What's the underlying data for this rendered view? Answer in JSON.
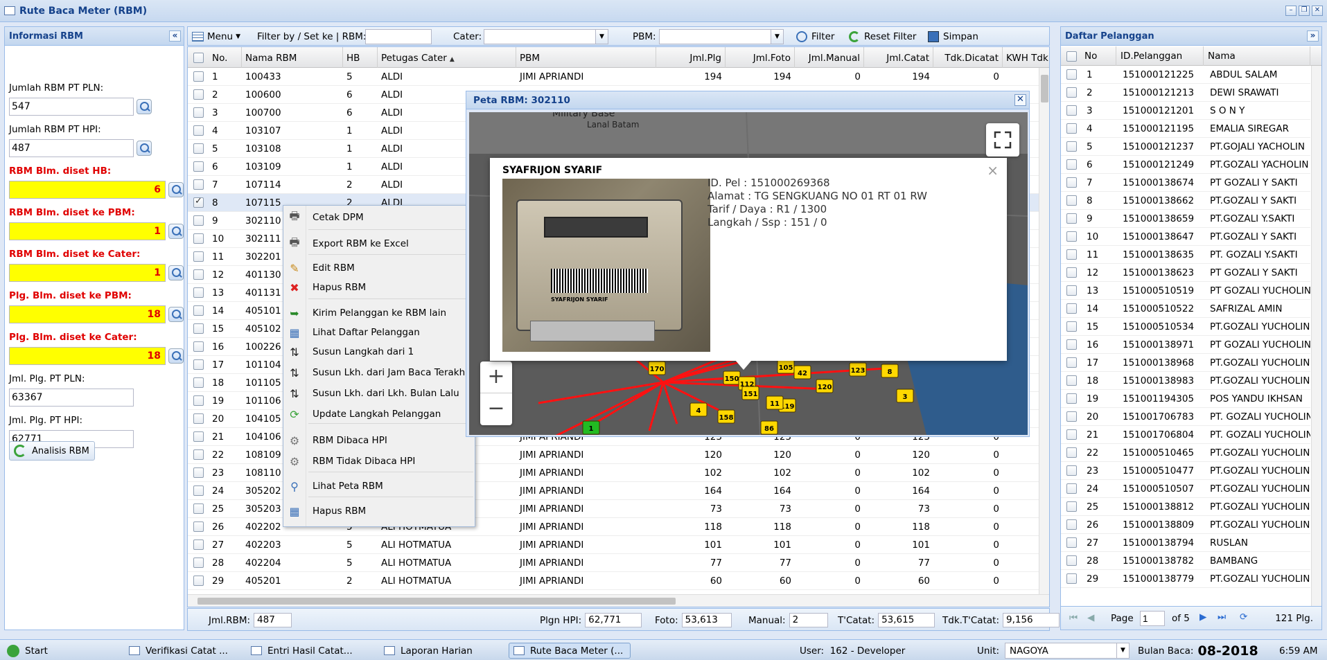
{
  "window": {
    "title": "Rute Baca Meter (RBM)"
  },
  "left_panel": {
    "title": "Informasi RBM",
    "fields": [
      {
        "label": "Jumlah RBM PT PLN:",
        "value": "547"
      },
      {
        "label": "Jumlah RBM PT HPI:",
        "value": "487"
      },
      {
        "label": "RBM Blm. diset HB:",
        "value": "6"
      },
      {
        "label": "RBM Blm. diset ke PBM:",
        "value": "1"
      },
      {
        "label": "RBM Blm. diset ke Cater:",
        "value": "1"
      },
      {
        "label": "Plg. Blm. diset ke PBM:",
        "value": "18"
      },
      {
        "label": "Plg. Blm. diset ke Cater:",
        "value": "18"
      },
      {
        "label": "Jml. Plg. PT PLN:",
        "value": "63367"
      },
      {
        "label": "Jml. Plg. PT HPI:",
        "value": "62771"
      }
    ],
    "analisis_button": "Analisis RBM"
  },
  "toolbar": {
    "menu_label": "Menu",
    "filter_label": "Filter by / Set ke | RBM:",
    "rbm_value": "",
    "cater_label": "Cater:",
    "cater_value": "",
    "pbm_label": "PBM:",
    "pbm_value": "",
    "filter_button": "Filter",
    "reset_button": "Reset Filter",
    "simpan_button": "Simpan"
  },
  "grid": {
    "columns": [
      "No.",
      "Nama RBM",
      "HB",
      "Petugas Cater",
      "PBM",
      "Jml.Plg",
      "Jml.Foto",
      "Jml.Manual",
      "Jml.Catat",
      "Tdk.Dicatat",
      "KWH Tdk Catat R"
    ],
    "rows": [
      [
        "1",
        "100433",
        "5",
        "ALDI",
        "JIMI APRIANDI",
        "194",
        "194",
        "0",
        "194",
        "0"
      ],
      [
        "2",
        "100600",
        "6",
        "ALDI",
        "",
        "",
        "",
        "",
        "",
        ""
      ],
      [
        "3",
        "100700",
        "6",
        "ALDI",
        "",
        "",
        "",
        "",
        "",
        ""
      ],
      [
        "4",
        "103107",
        "1",
        "ALDI",
        "",
        "",
        "",
        "",
        "",
        ""
      ],
      [
        "5",
        "103108",
        "1",
        "ALDI",
        "",
        "",
        "",
        "",
        "",
        ""
      ],
      [
        "6",
        "103109",
        "1",
        "ALDI",
        "",
        "",
        "",
        "",
        "",
        ""
      ],
      [
        "7",
        "107114",
        "2",
        "ALDI",
        "",
        "",
        "",
        "",
        "",
        ""
      ],
      [
        "8",
        "107115",
        "2",
        "ALDI",
        "",
        "",
        "",
        "",
        "",
        ""
      ],
      [
        "9",
        "302110",
        "",
        "",
        "",
        "",
        "",
        "",
        "",
        ""
      ],
      [
        "10",
        "302111",
        "",
        "",
        "",
        "",
        "",
        "",
        "",
        ""
      ],
      [
        "11",
        "302201",
        "",
        "",
        "",
        "",
        "",
        "",
        "",
        ""
      ],
      [
        "12",
        "401130",
        "",
        "",
        "",
        "",
        "",
        "",
        "",
        ""
      ],
      [
        "13",
        "401131",
        "",
        "",
        "",
        "",
        "",
        "",
        "",
        ""
      ],
      [
        "14",
        "405101",
        "",
        "",
        "",
        "",
        "",
        "",
        "",
        ""
      ],
      [
        "15",
        "405102",
        "",
        "",
        "",
        "",
        "",
        "",
        "",
        ""
      ],
      [
        "16",
        "100226",
        "",
        "",
        "",
        "",
        "",
        "",
        "",
        ""
      ],
      [
        "17",
        "101104",
        "",
        "",
        "",
        "",
        "",
        "",
        "",
        ""
      ],
      [
        "18",
        "101105",
        "",
        "",
        "",
        "",
        "",
        "",
        "",
        ""
      ],
      [
        "19",
        "101106",
        "",
        "",
        "",
        "",
        "",
        "",
        "",
        ""
      ],
      [
        "20",
        "104105",
        "",
        "",
        "",
        "",
        "",
        "",
        "",
        ""
      ],
      [
        "21",
        "104106",
        "",
        "",
        "JIMI APRIANDI",
        "123",
        "123",
        "0",
        "123",
        "0"
      ],
      [
        "22",
        "108109",
        "",
        "",
        "JIMI APRIANDI",
        "120",
        "120",
        "0",
        "120",
        "0"
      ],
      [
        "23",
        "108110",
        "",
        "",
        "JIMI APRIANDI",
        "102",
        "102",
        "0",
        "102",
        "0"
      ],
      [
        "24",
        "305202",
        "",
        "",
        "JIMI APRIANDI",
        "164",
        "164",
        "0",
        "164",
        "0"
      ],
      [
        "25",
        "305203",
        "",
        "",
        "JIMI APRIANDI",
        "73",
        "73",
        "0",
        "73",
        "0"
      ],
      [
        "26",
        "402202",
        "5",
        "ALI HOTMATUA",
        "JIMI APRIANDI",
        "118",
        "118",
        "0",
        "118",
        "0"
      ],
      [
        "27",
        "402203",
        "5",
        "ALI HOTMATUA",
        "JIMI APRIANDI",
        "101",
        "101",
        "0",
        "101",
        "0"
      ],
      [
        "28",
        "402204",
        "5",
        "ALI HOTMATUA",
        "JIMI APRIANDI",
        "77",
        "77",
        "0",
        "77",
        "0"
      ],
      [
        "29",
        "405201",
        "2",
        "ALI HOTMATUA",
        "JIMI APRIANDI",
        "60",
        "60",
        "0",
        "60",
        "0"
      ]
    ],
    "selected_row": 7
  },
  "bottom_bar": {
    "jml_rbm_label": "Jml.RBM:",
    "jml_rbm": "487",
    "plgn_hpi_label": "Plgn HPI:",
    "plgn_hpi": "62,771",
    "foto_label": "Foto:",
    "foto": "53,613",
    "manual_label": "Manual:",
    "manual": "2",
    "tcatat_label": "T'Catat:",
    "tcatat": "53,615",
    "tdk_label": "Tdk.T'Catat:",
    "tdk": "9,156"
  },
  "context_menu": {
    "items": [
      {
        "label": "Cetak DPM",
        "icon": "printer-icon"
      },
      {
        "label": "Export RBM ke Excel",
        "icon": "printer-icon"
      },
      {
        "label": "Edit RBM",
        "icon": "edit-icon"
      },
      {
        "label": "Hapus RBM",
        "icon": "delete-icon"
      },
      {
        "label": "Kirim Pelanggan ke RBM lain",
        "icon": "send-icon"
      },
      {
        "label": "Lihat Daftar Pelanggan",
        "icon": "grid-icon"
      },
      {
        "label": "Susun Langkah dari 1",
        "icon": "sort-icon"
      },
      {
        "label": "Susun Lkh. dari Jam Baca Terakhir",
        "icon": "sort-icon"
      },
      {
        "label": "Susun Lkh. dari Lkh. Bulan Lalu",
        "icon": "sort-icon"
      },
      {
        "label": "Update Langkah Pelanggan",
        "icon": "refresh-icon"
      },
      {
        "label": "RBM Dibaca HPI",
        "icon": "gear-icon"
      },
      {
        "label": "RBM Tidak Dibaca HPI",
        "icon": "gear-icon"
      },
      {
        "label": "Lihat Peta RBM",
        "icon": "search-icon"
      },
      {
        "label": "Hapus RBM",
        "icon": "grid-icon"
      }
    ]
  },
  "map_window": {
    "title": "Peta RBM: 302110",
    "map_labels": [
      "Military Base",
      "Lanal Batam"
    ],
    "popup": {
      "name": "SYAFRIJON SYARIF",
      "lines": [
        "ID. Pel : 151000269368",
        "Alamat : TG SENGKUANG NO 01 RT 01 RW",
        "Tarif / Daya : R1 / 1300",
        "Langkah / Ssp : 151 / 0"
      ],
      "photo_label": "SYAFRIJON SYARIF"
    },
    "markers": [
      "170",
      "150",
      "112",
      "151",
      "119",
      "11",
      "158",
      "86",
      "105",
      "42",
      "120",
      "123",
      "8",
      "3",
      "1",
      "4"
    ]
  },
  "right_panel": {
    "title": "Daftar Pelanggan",
    "columns": [
      "No",
      "ID.Pelanggan",
      "Nama"
    ],
    "rows": [
      [
        "1",
        "151000121225",
        "ABDUL SALAM"
      ],
      [
        "2",
        "151000121213",
        "DEWI SRAWATI"
      ],
      [
        "3",
        "151000121201",
        "S O N Y"
      ],
      [
        "4",
        "151000121195",
        "EMALIA SIREGAR"
      ],
      [
        "5",
        "151000121237",
        "PT.GOJALI YACHOLIN"
      ],
      [
        "6",
        "151000121249",
        "PT.GOZALI YACHOLIN"
      ],
      [
        "7",
        "151000138674",
        "PT GOZALI Y SAKTI"
      ],
      [
        "8",
        "151000138662",
        "PT.GOZALI Y SAKTI"
      ],
      [
        "9",
        "151000138659",
        "PT.GOZALI Y.SAKTI"
      ],
      [
        "10",
        "151000138647",
        "PT.GOZALI Y SAKTI"
      ],
      [
        "11",
        "151000138635",
        "PT. GOZALI Y.SAKTI"
      ],
      [
        "12",
        "151000138623",
        "PT GOZALI Y SAKTI"
      ],
      [
        "13",
        "151000510519",
        "PT GOZALI YUCHOLIN"
      ],
      [
        "14",
        "151000510522",
        "SAFRIZAL AMIN"
      ],
      [
        "15",
        "151000510534",
        "PT.GOZALI YUCHOLIN"
      ],
      [
        "16",
        "151000138971",
        "PT GOZALI YUCHOLIN"
      ],
      [
        "17",
        "151000138968",
        "PT.GOZALI YUCHOLIN"
      ],
      [
        "18",
        "151000138983",
        "PT.GOZALI YUCHOLIN"
      ],
      [
        "19",
        "151001194305",
        "POS YANDU IKHSAN"
      ],
      [
        "20",
        "151001706783",
        "PT. GOZALI YUCHOLIN"
      ],
      [
        "21",
        "151001706804",
        "PT. GOZALI YUCHOLIN"
      ],
      [
        "22",
        "151000510465",
        "PT.GOZALI YUCHOLIN"
      ],
      [
        "23",
        "151000510477",
        "PT.GOZALI YUCHOLIN"
      ],
      [
        "24",
        "151000510507",
        "PT.GOZALI YUCHOLIN"
      ],
      [
        "25",
        "151000138812",
        "PT.GOZALI YUCHOLIN"
      ],
      [
        "26",
        "151000138809",
        "PT.GOZALI YUCHOLIN"
      ],
      [
        "27",
        "151000138794",
        "RUSLAN"
      ],
      [
        "28",
        "151000138782",
        "BAMBANG"
      ],
      [
        "29",
        "151000138779",
        "PT.GOZALI YUCHOLIN"
      ]
    ],
    "paging": {
      "page_label": "Page",
      "page": "1",
      "of_label": "of 5",
      "total": "121 Plg."
    }
  },
  "taskbar": {
    "start": "Start",
    "tasks": [
      "Verifikasi Catat ...",
      "Entri Hasil Catat...",
      "Laporan Harian",
      "Rute Baca Meter (..."
    ],
    "user_label": "User:",
    "user": "162 - Developer",
    "unit_label": "Unit:",
    "unit": "NAGOYA",
    "bulan_label": "Bulan Baca:",
    "bulan": "08-2018",
    "clock": "6:59 AM"
  },
  "colors": {
    "header_blue": "#15428b",
    "highlight_yellow": "#ffff00",
    "alert_red": "#e00000"
  }
}
